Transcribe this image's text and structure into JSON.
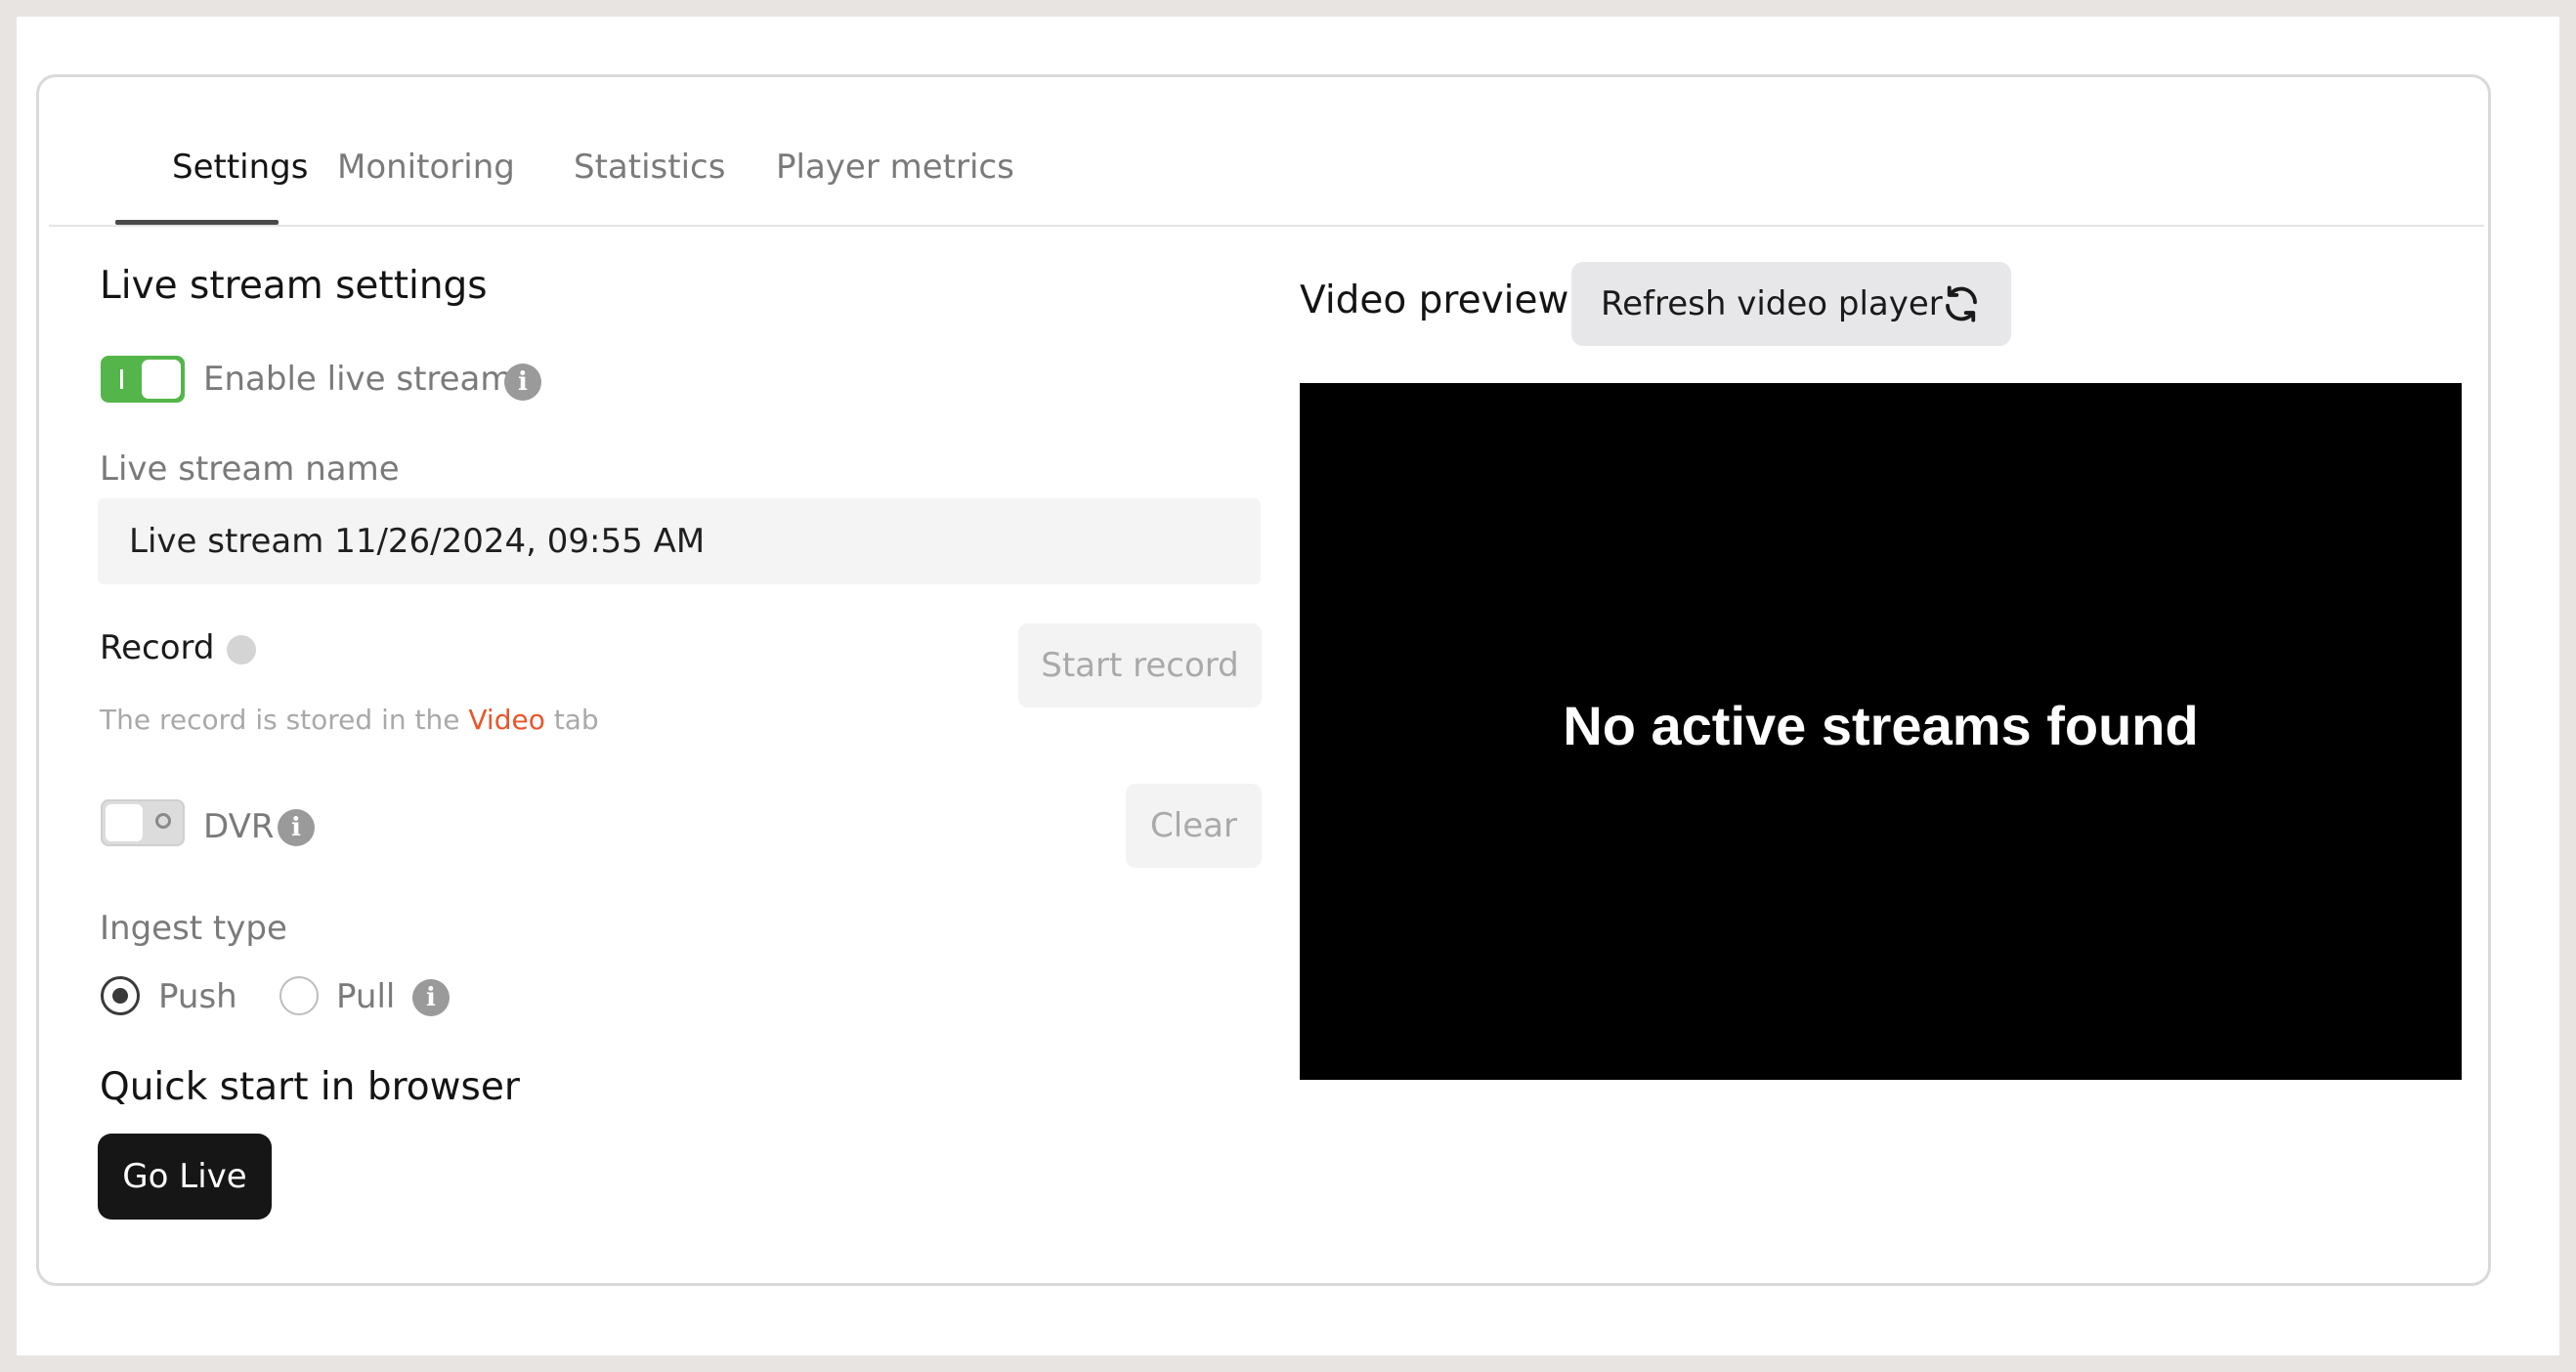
{
  "tabs": [
    {
      "label": "Settings",
      "active": true
    },
    {
      "label": "Monitoring",
      "active": false
    },
    {
      "label": "Statistics",
      "active": false
    },
    {
      "label": "Player metrics",
      "active": false
    }
  ],
  "settings": {
    "title": "Live stream settings",
    "enable_live_stream": {
      "label": "Enable live stream",
      "enabled": true
    },
    "name_label": "Live stream name",
    "name_value": "Live stream 11/26/2024, 09:55 AM",
    "record": {
      "label": "Record",
      "hint_prefix": "The record is stored in the",
      "hint_link": "Video",
      "hint_suffix": "tab",
      "start_button": "Start record"
    },
    "dvr": {
      "label": "DVR",
      "enabled": false,
      "clear_button": "Clear"
    },
    "ingest": {
      "label": "Ingest type",
      "options": [
        {
          "label": "Push",
          "selected": true
        },
        {
          "label": "Pull",
          "selected": false
        }
      ]
    },
    "quick_start": {
      "title": "Quick start in browser",
      "button": "Go Live"
    }
  },
  "preview": {
    "title": "Video preview",
    "refresh_button": "Refresh video player",
    "empty_message": "No active streams found"
  },
  "colors": {
    "toggle_on": "#54b54a",
    "link": "#e8562a",
    "primary_button": "#161616",
    "video_bg": "#000000"
  }
}
